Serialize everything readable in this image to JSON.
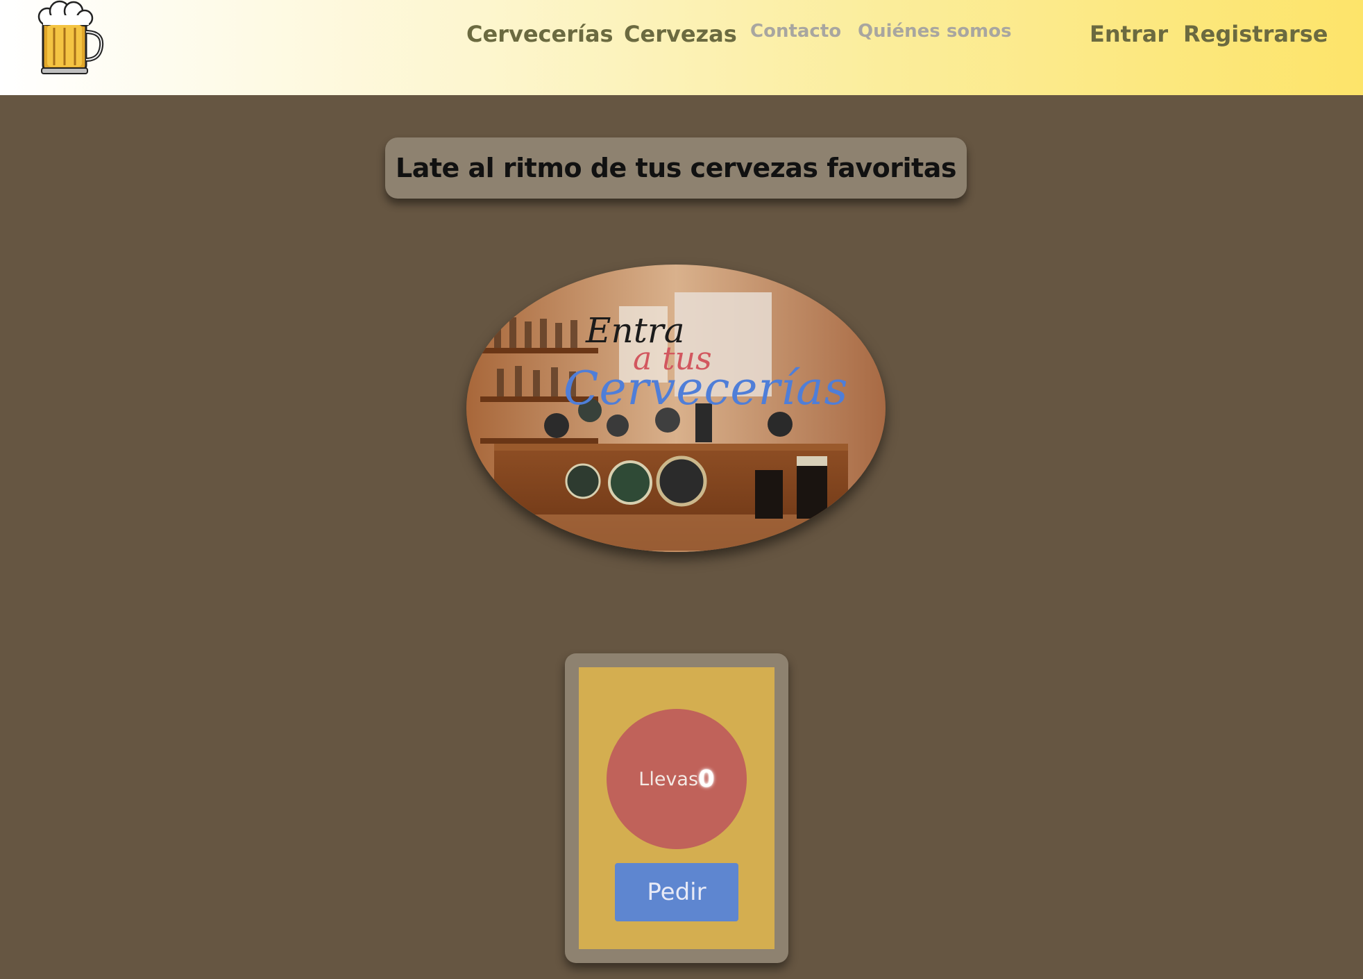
{
  "header": {
    "logo_icon": "beer-mug-icon",
    "nav": {
      "cervecerias": "Cervecerías",
      "cervezas": "Cervezas",
      "contacto": "Contacto",
      "quienes": "Quiénes somos",
      "entrar": "Entrar",
      "registrarse": "Registrarse"
    },
    "gradient_colors": [
      "#ffffff",
      "#fde46a"
    ],
    "link_color": "#6b6a40",
    "minor_link_color": "#a8a6a0"
  },
  "tagline": "Late al ritmo de tus cervezas favoritas",
  "hero_image": {
    "line1": "Entra",
    "line2": "a tus",
    "line3": "Cervecerías"
  },
  "counter": {
    "label": "Llevas",
    "value": "0",
    "button": "Pedir"
  },
  "colors": {
    "page_background": "#665642",
    "box_background": "#8e8270",
    "card_inner": "#d4ae50",
    "counter_circle": "#c0625a",
    "button": "#5e86d0"
  }
}
